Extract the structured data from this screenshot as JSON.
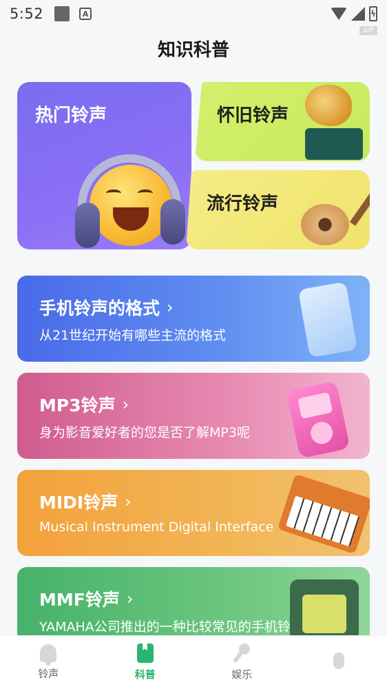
{
  "status_bar": {
    "time": "5:52",
    "notif_letter": "A",
    "battery_symbol": "ϟ",
    "badge": "aiff"
  },
  "page": {
    "title": "知识科普"
  },
  "categories": {
    "hot": {
      "label": "热门铃声"
    },
    "nostalgic": {
      "label": "怀旧铃声"
    },
    "popular": {
      "label": "流行铃声"
    }
  },
  "topics": [
    {
      "title": "手机铃声的格式",
      "subtitle": "从21世纪开始有哪些主流的格式"
    },
    {
      "title": "MP3铃声",
      "subtitle": "身为影音爱好者的您是否了解MP3呢"
    },
    {
      "title": "MIDI铃声",
      "subtitle": "Musical Instrument Digital Interface"
    },
    {
      "title": "MMF铃声",
      "subtitle": "YAMAHA公司推出的一种比较常见的手机铃..."
    }
  ],
  "chevron": "›",
  "bottom_nav": [
    {
      "label": "铃声",
      "icon": "bell-icon"
    },
    {
      "label": "科普",
      "icon": "book-icon"
    },
    {
      "label": "娱乐",
      "icon": "microphone-icon"
    },
    {
      "label": "",
      "icon": "mouse-icon"
    }
  ],
  "colors": {
    "accent": "#2bb572",
    "hot_card": "#8b6ff5",
    "nostalgic_card": "#cdea62",
    "popular_card": "#f3e878",
    "format_card": "#5a7ff0",
    "mp3_card": "#df7aa8",
    "midi_card": "#f2b04e",
    "mmf_card": "#5fbf75"
  }
}
